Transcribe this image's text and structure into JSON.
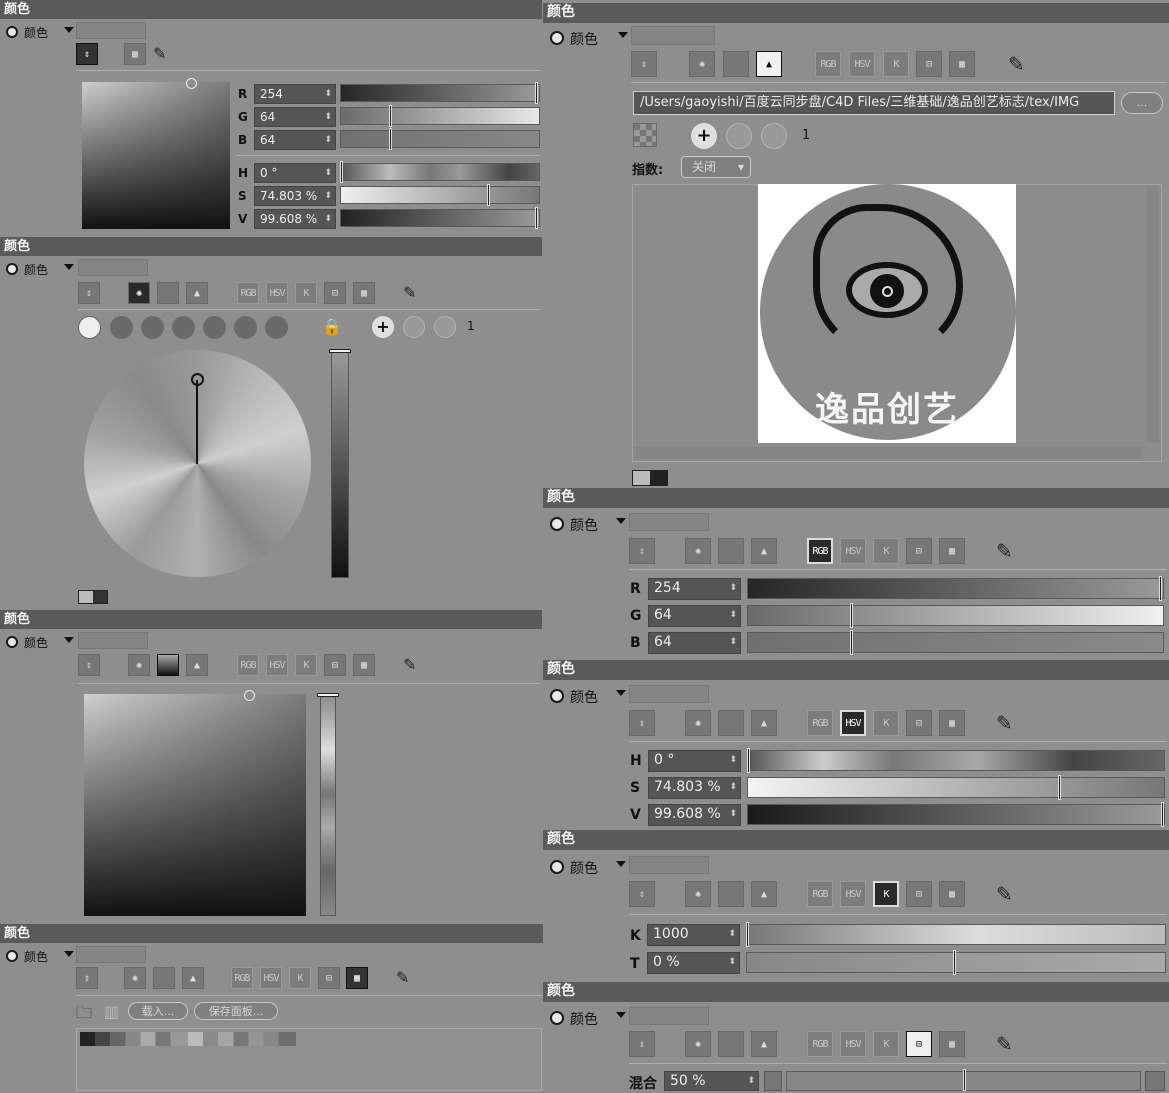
{
  "panel_title": "颜色",
  "color_label": "颜色",
  "rgb": {
    "r_label": "R",
    "g_label": "G",
    "b_label": "B",
    "r": "254",
    "g": "64",
    "b": "64"
  },
  "hsv": {
    "h_label": "H",
    "s_label": "S",
    "v_label": "V",
    "h": "0 °",
    "s": "74.803 %",
    "v": "99.608 %"
  },
  "mode_buttons": {
    "rgb": "RGB",
    "hsv": "HSV",
    "k": "K"
  },
  "wheel_count": "1",
  "image_panel": {
    "path": "/Users/gaoyishi/百度云同步盘/C4D Files/三维基础/逸品创艺标志/tex/IMG",
    "browse": "...",
    "count": "1",
    "index_label": "指数:",
    "index_value": "关闭",
    "logo_text": "逸品创艺"
  },
  "swatches": {
    "load": "载入...",
    "save": "保存面板..."
  },
  "kelvin": {
    "k_label": "K",
    "t_label": "T",
    "k": "1000",
    "t": "0 %"
  },
  "mix": {
    "label": "混合",
    "value": "50 %"
  },
  "colors": {
    "header": "#5a5a5a",
    "panel": "#8e8e8e",
    "field": "#555555"
  }
}
